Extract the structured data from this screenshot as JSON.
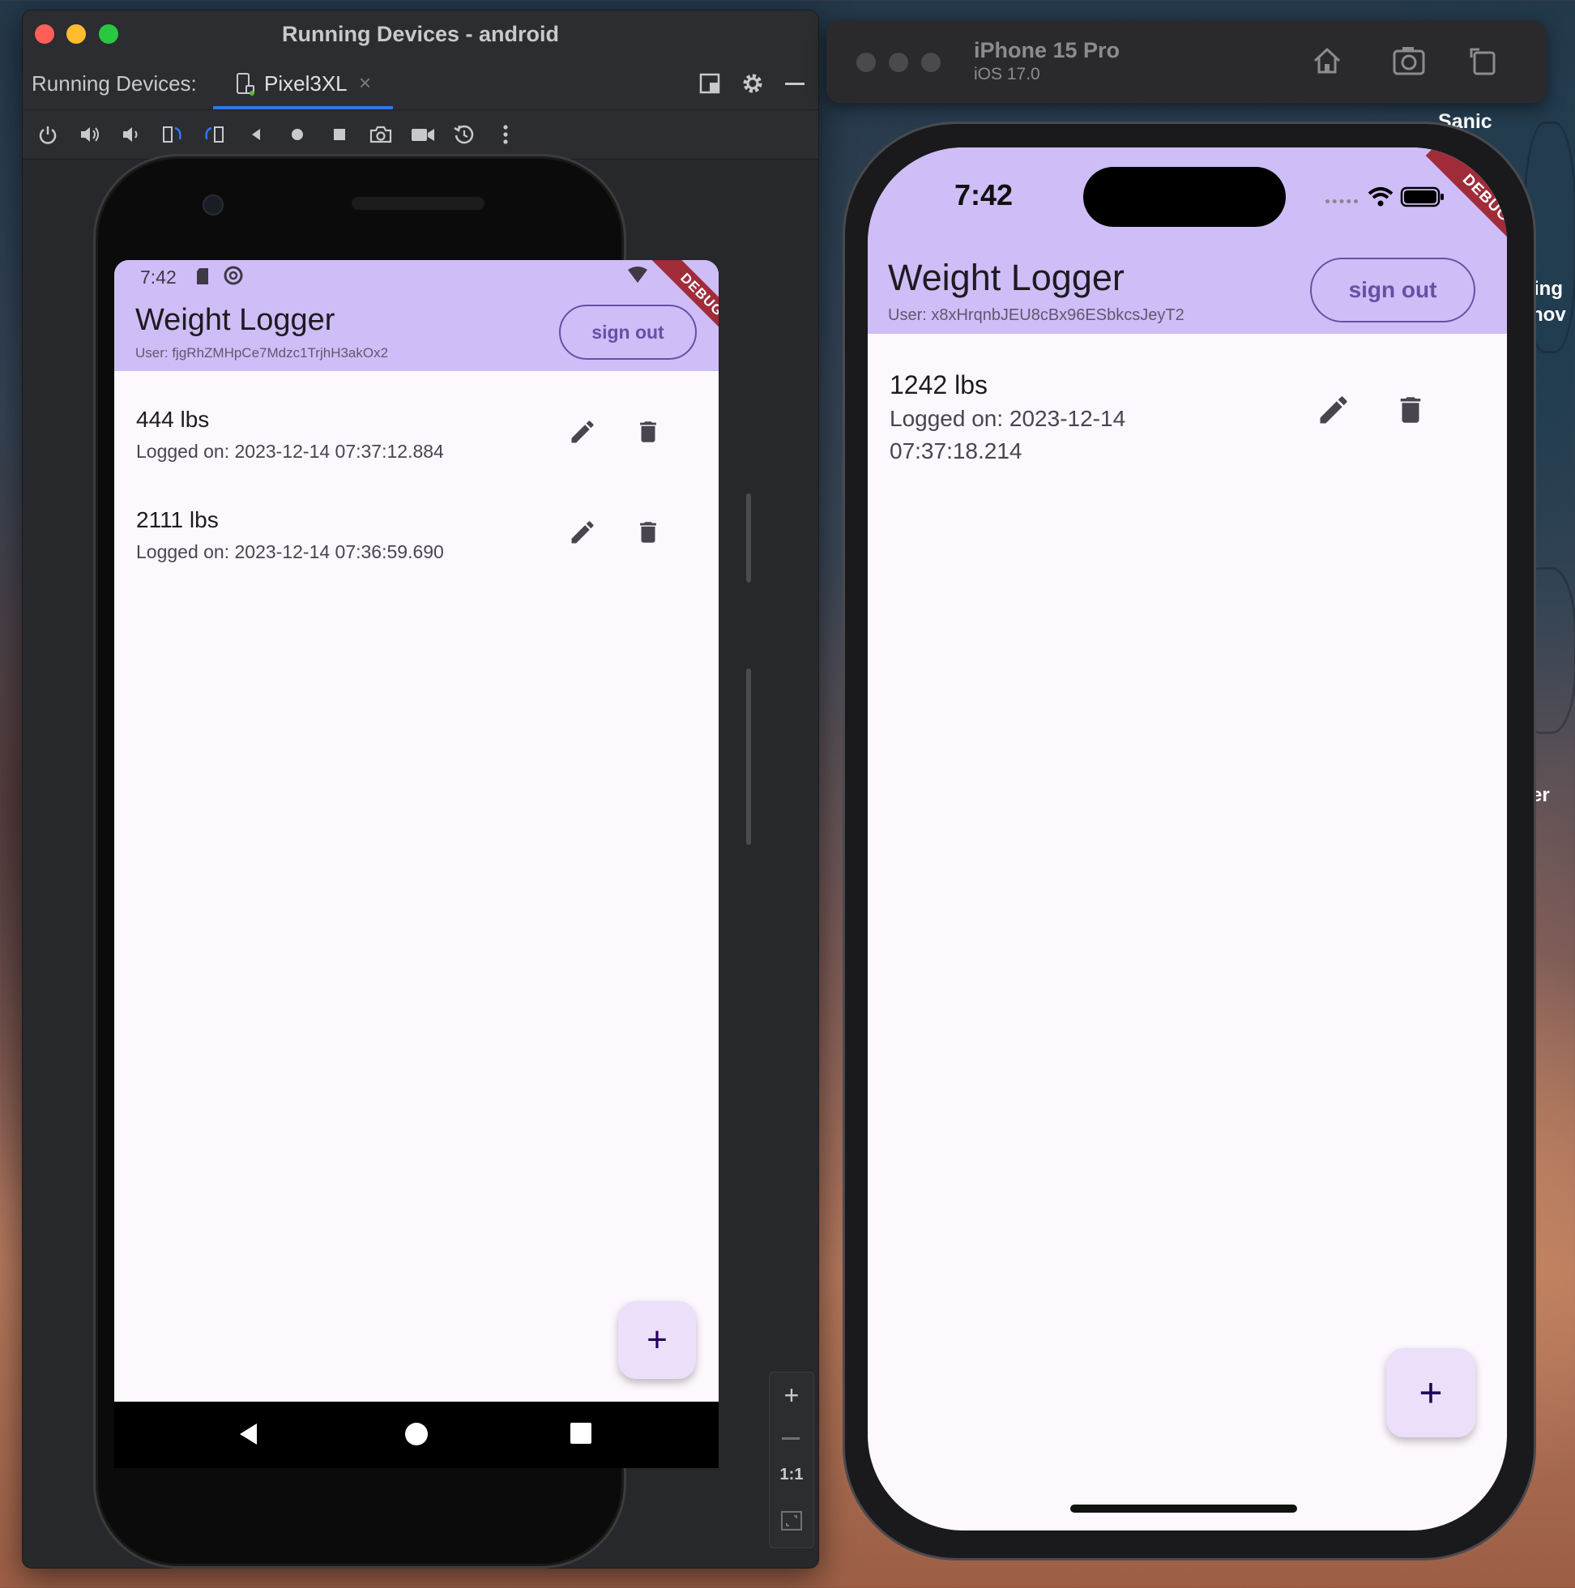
{
  "android_studio": {
    "window_title": "Running Devices - android",
    "panel_label": "Running Devices:",
    "device_tab": "Pixel3XL",
    "zoom_ratio": "1:1"
  },
  "android_app": {
    "status_time": "7:42",
    "title": "Weight Logger",
    "user": "User: fjgRhZMHpCe7Mdzc1TrjhH3akOx2",
    "sign_out": "sign out",
    "debug": "DEBUG",
    "entries": [
      {
        "weight": "444 lbs",
        "logged": "Logged on: 2023-12-14 07:37:12.884"
      },
      {
        "weight": "2111 lbs",
        "logged": "Logged on: 2023-12-14 07:36:59.690"
      }
    ],
    "fab": "+"
  },
  "ios_sim": {
    "device_name": "iPhone 15 Pro",
    "os_version": "iOS 17.0"
  },
  "ios_app": {
    "status_time": "7:42",
    "title": "Weight Logger",
    "user": "User: x8xHrqnbJEU8cBx96ESbkcsJeyT2",
    "sign_out": "sign out",
    "debug": "DEBUG",
    "entries": [
      {
        "weight": "1242 lbs",
        "logged_line1": "Logged on: 2023-12-14",
        "logged_line2": "07:37:18.214"
      }
    ],
    "fab": "+"
  },
  "desktop": {
    "label_sanic": "Sanic",
    "partial_1": "ing",
    "partial_2": "nov",
    "partial_3": "er"
  },
  "colors": {
    "appbar": "#cfbdf7",
    "primary": "#6750a4",
    "debug_ribbon": "#a02c3a",
    "surface": "#fdf8fd"
  }
}
